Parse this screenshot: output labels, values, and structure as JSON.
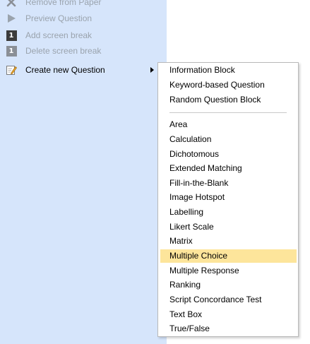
{
  "left_menu": {
    "items": [
      {
        "label": "Remove from Paper",
        "icon": "close-icon",
        "enabled": false
      },
      {
        "label": "Preview Question",
        "icon": "play-icon",
        "enabled": false
      },
      {
        "label": "Add screen break",
        "icon": "screen-break-icon",
        "icon_text": "1",
        "enabled": false
      },
      {
        "label": "Delete screen break",
        "icon": "screen-break-icon",
        "icon_text": "1",
        "enabled": false
      },
      {
        "label": "Create new Question",
        "icon": "edit-icon",
        "enabled": true,
        "has_submenu": true
      }
    ]
  },
  "submenu": {
    "blocks": [
      "Information Block",
      "Keyword-based Question",
      "Random Question Block"
    ],
    "question_types": [
      "Area",
      "Calculation",
      "Dichotomous",
      "Extended Matching",
      "Fill-in-the-Blank",
      "Image Hotspot",
      "Labelling",
      "Likert Scale",
      "Matrix",
      "Multiple Choice",
      "Multiple Response",
      "Ranking",
      "Script Concordance Test",
      "Text Box",
      "True/False"
    ],
    "highlighted": "Multiple Choice"
  },
  "colors": {
    "panel_background": "#d6e5fb",
    "highlight": "#fde59b",
    "disabled_text": "#9aa3ad"
  }
}
